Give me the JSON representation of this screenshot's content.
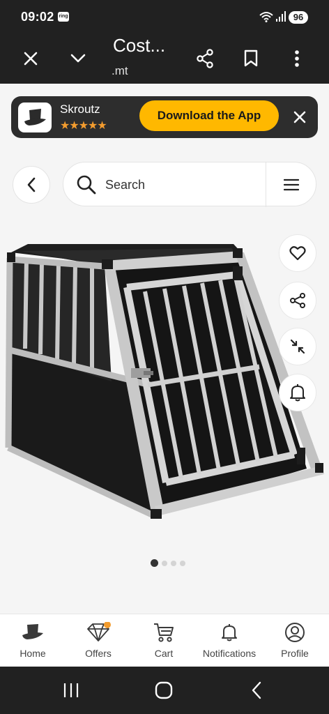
{
  "status_bar": {
    "time": "09:02",
    "ring_label": "ring",
    "battery": "96"
  },
  "toolbar": {
    "title": "Cost...",
    "url": ".mt",
    "icons": [
      "close-icon",
      "chevron-down-icon",
      "share-icon",
      "bookmark-icon",
      "more-vert-icon"
    ]
  },
  "app_banner": {
    "app_name": "Skroutz",
    "rating_stars": "★★★★★",
    "download_label": "Download the App"
  },
  "search": {
    "placeholder": "Search"
  },
  "product_actions": [
    "heart-icon",
    "share-icon",
    "collapse-icon",
    "bell-icon"
  ],
  "gallery": {
    "total_images": 4,
    "active_index": 0
  },
  "bottom_nav": {
    "items": [
      {
        "label": "Home",
        "icon": "home-hat-icon"
      },
      {
        "label": "Offers",
        "icon": "diamond-icon"
      },
      {
        "label": "Cart",
        "icon": "cart-icon"
      },
      {
        "label": "Notifications",
        "icon": "bell-icon"
      },
      {
        "label": "Profile",
        "icon": "profile-icon"
      }
    ]
  },
  "colors": {
    "accent": "#ffb800",
    "offers_badge": "#f39c2e",
    "dark_bar": "#212121"
  }
}
